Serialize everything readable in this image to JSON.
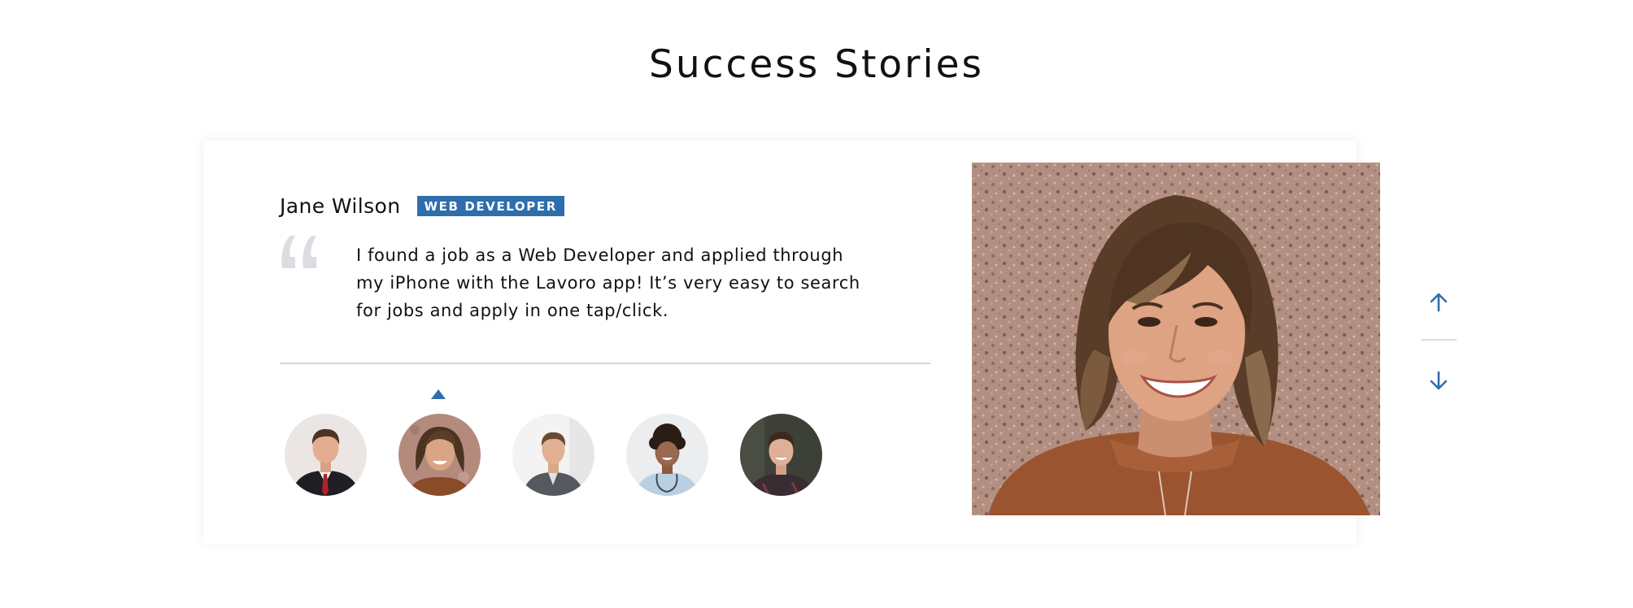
{
  "section": {
    "title": "Success Stories"
  },
  "testimonial": {
    "name": "Jane Wilson",
    "role": "WEB DEVELOPER",
    "quote": "I found a job as a Web Developer and applied through my iPhone with the Lavoro app! It’s very easy to search for jobs and apply in one tap/click."
  },
  "avatars": {
    "selected_index": 1,
    "count": 5
  },
  "colors": {
    "accent": "#2f6eac",
    "quote_mark": "#dcdde3",
    "divider": "#d6d6d6"
  },
  "icons": {
    "quote": "quote-mark-icon",
    "up": "arrow-up-icon",
    "down": "arrow-down-icon"
  }
}
